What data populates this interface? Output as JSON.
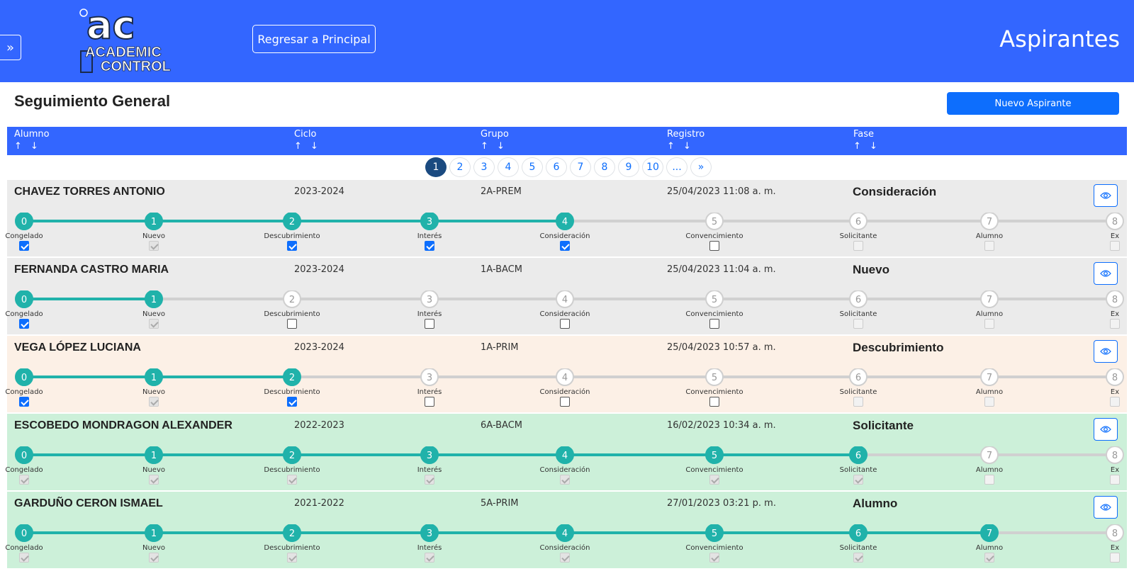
{
  "header": {
    "logo_text_top": "ac",
    "logo_text_line1": "ACADEMIC",
    "logo_text_line2": "CONTROL",
    "back_button": "Regresar a Principal",
    "page_title": "Aspirantes",
    "sidebar_toggle": "»"
  },
  "section_title": "Seguimiento General",
  "new_button": "Nuevo Aspirante",
  "columns": [
    {
      "label": "Alumno",
      "sort": "↑ ↓"
    },
    {
      "label": "Ciclo",
      "sort": "↑ ↓"
    },
    {
      "label": "Grupo",
      "sort": "↑ ↓"
    },
    {
      "label": "Registro",
      "sort": "↑ ↓"
    },
    {
      "label": "Fase",
      "sort": "↑ ↓"
    }
  ],
  "pagination": [
    "1",
    "2",
    "3",
    "4",
    "5",
    "6",
    "7",
    "8",
    "9",
    "10",
    "...",
    "»"
  ],
  "pagination_active": "1",
  "stages": [
    "Congelado",
    "Nuevo",
    "Descubrimiento",
    "Interés",
    "Consideración",
    "Convencimiento",
    "Solicitante",
    "Alumno",
    "Ex"
  ],
  "stage_numbers": [
    "0",
    "1",
    "2",
    "3",
    "4",
    "5",
    "6",
    "7",
    "8"
  ],
  "colors": {
    "header": "#3366ff",
    "accent": "#20b2aa",
    "row_gray": "#ebebeb",
    "row_peach": "#fcf0e6",
    "row_green": "#ccf0d9"
  },
  "rows": [
    {
      "name": "CHAVEZ TORRES ANTONIO",
      "ciclo": "2023-2024",
      "grupo": "2A-PREM",
      "registro": "25/04/2023 11:08 a. m.",
      "fase": "Consideración",
      "progress": 4,
      "bg": "#ebebeb",
      "checks": [
        1,
        1,
        1,
        1,
        1,
        0,
        0,
        0,
        0
      ],
      "enabled": [
        1,
        0,
        1,
        1,
        1,
        1,
        0,
        0,
        0
      ]
    },
    {
      "name": "FERNANDA CASTRO MARIA",
      "ciclo": "2023-2024",
      "grupo": "1A-BACM",
      "registro": "25/04/2023 11:04 a. m.",
      "fase": "Nuevo",
      "progress": 1,
      "bg": "#ebebeb",
      "checks": [
        1,
        1,
        0,
        0,
        0,
        0,
        0,
        0,
        0
      ],
      "enabled": [
        1,
        0,
        1,
        1,
        1,
        1,
        0,
        0,
        0
      ]
    },
    {
      "name": "VEGA LÓPEZ LUCIANA",
      "ciclo": "2023-2024",
      "grupo": "1A-PRIM",
      "registro": "25/04/2023 10:57 a. m.",
      "fase": "Descubrimiento",
      "progress": 2,
      "bg": "#fcf0e6",
      "checks": [
        1,
        1,
        1,
        0,
        0,
        0,
        0,
        0,
        0
      ],
      "enabled": [
        1,
        0,
        1,
        1,
        1,
        1,
        0,
        0,
        0
      ]
    },
    {
      "name": "ESCOBEDO MONDRAGON ALEXANDER",
      "ciclo": "2022-2023",
      "grupo": "6A-BACM",
      "registro": "16/02/2023 10:34 a. m.",
      "fase": "Solicitante",
      "progress": 6,
      "bg": "#ccf0d9",
      "checks": [
        1,
        1,
        1,
        1,
        1,
        1,
        1,
        0,
        0
      ],
      "enabled": [
        0,
        0,
        0,
        0,
        0,
        0,
        0,
        0,
        0
      ]
    },
    {
      "name": "GARDUÑO CERON ISMAEL",
      "ciclo": "2021-2022",
      "grupo": "5A-PRIM",
      "registro": "27/01/2023 03:21 p. m.",
      "fase": "Alumno",
      "progress": 7,
      "bg": "#ccf0d9",
      "checks": [
        1,
        1,
        1,
        1,
        1,
        1,
        1,
        1,
        0
      ],
      "enabled": [
        0,
        0,
        0,
        0,
        0,
        0,
        0,
        0,
        0
      ]
    }
  ]
}
